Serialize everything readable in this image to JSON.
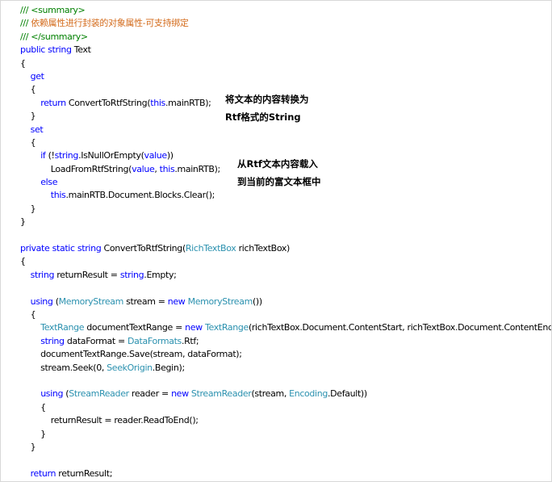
{
  "code_lines": [
    [
      {
        "t": "/// <summary>",
        "c": "cm"
      }
    ],
    [
      {
        "t": "/// ",
        "c": "cm"
      },
      {
        "t": "依赖属性进行封装的对象属性-可支持绑定",
        "c": "cm-cn"
      }
    ],
    [
      {
        "t": "/// </summary>",
        "c": "cm"
      }
    ],
    [
      {
        "t": "public",
        "c": "kw"
      },
      {
        "t": " "
      },
      {
        "t": "string",
        "c": "kw"
      },
      {
        "t": " Text"
      }
    ],
    [
      {
        "t": "{"
      }
    ],
    [
      {
        "t": "    "
      },
      {
        "t": "get",
        "c": "kw"
      }
    ],
    [
      {
        "t": "    {"
      }
    ],
    [
      {
        "t": "        "
      },
      {
        "t": "return",
        "c": "kw"
      },
      {
        "t": " ConvertToRtfString("
      },
      {
        "t": "this",
        "c": "kw"
      },
      {
        "t": ".mainRTB);"
      }
    ],
    [
      {
        "t": "    }"
      }
    ],
    [
      {
        "t": "    "
      },
      {
        "t": "set",
        "c": "kw"
      }
    ],
    [
      {
        "t": "    {"
      }
    ],
    [
      {
        "t": "        "
      },
      {
        "t": "if",
        "c": "kw"
      },
      {
        "t": " (!"
      },
      {
        "t": "string",
        "c": "kw"
      },
      {
        "t": ".IsNullOrEmpty("
      },
      {
        "t": "value",
        "c": "kw"
      },
      {
        "t": "))"
      }
    ],
    [
      {
        "t": "            LoadFromRtfString("
      },
      {
        "t": "value",
        "c": "kw"
      },
      {
        "t": ", "
      },
      {
        "t": "this",
        "c": "kw"
      },
      {
        "t": ".mainRTB);"
      }
    ],
    [
      {
        "t": "        "
      },
      {
        "t": "else",
        "c": "kw"
      }
    ],
    [
      {
        "t": "            "
      },
      {
        "t": "this",
        "c": "kw"
      },
      {
        "t": ".mainRTB.Document.Blocks.Clear();"
      }
    ],
    [
      {
        "t": "    }"
      }
    ],
    [
      {
        "t": "}"
      }
    ],
    [
      {
        "t": ""
      }
    ],
    [
      {
        "t": "private",
        "c": "kw"
      },
      {
        "t": " "
      },
      {
        "t": "static",
        "c": "kw"
      },
      {
        "t": " "
      },
      {
        "t": "string",
        "c": "kw"
      },
      {
        "t": " ConvertToRtfString("
      },
      {
        "t": "RichTextBox",
        "c": "ty"
      },
      {
        "t": " richTextBox)"
      }
    ],
    [
      {
        "t": "{"
      }
    ],
    [
      {
        "t": "    "
      },
      {
        "t": "string",
        "c": "kw"
      },
      {
        "t": " returnResult = "
      },
      {
        "t": "string",
        "c": "kw"
      },
      {
        "t": ".Empty;"
      }
    ],
    [
      {
        "t": ""
      }
    ],
    [
      {
        "t": "    "
      },
      {
        "t": "using",
        "c": "kw"
      },
      {
        "t": " ("
      },
      {
        "t": "MemoryStream",
        "c": "ty"
      },
      {
        "t": " stream = "
      },
      {
        "t": "new",
        "c": "kw"
      },
      {
        "t": " "
      },
      {
        "t": "MemoryStream",
        "c": "ty"
      },
      {
        "t": "())"
      }
    ],
    [
      {
        "t": "    {"
      }
    ],
    [
      {
        "t": "        "
      },
      {
        "t": "TextRange",
        "c": "ty"
      },
      {
        "t": " documentTextRange = "
      },
      {
        "t": "new",
        "c": "kw"
      },
      {
        "t": " "
      },
      {
        "t": "TextRange",
        "c": "ty"
      },
      {
        "t": "(richTextBox.Document.ContentStart, richTextBox.Document.ContentEnd);"
      }
    ],
    [
      {
        "t": "        "
      },
      {
        "t": "string",
        "c": "kw"
      },
      {
        "t": " dataFormat = "
      },
      {
        "t": "DataFormats",
        "c": "ty"
      },
      {
        "t": ".Rtf;"
      }
    ],
    [
      {
        "t": "        documentTextRange.Save(stream, dataFormat);"
      }
    ],
    [
      {
        "t": "        stream.Seek(0, "
      },
      {
        "t": "SeekOrigin",
        "c": "ty"
      },
      {
        "t": ".Begin);"
      }
    ],
    [
      {
        "t": ""
      }
    ],
    [
      {
        "t": "        "
      },
      {
        "t": "using",
        "c": "kw"
      },
      {
        "t": " ("
      },
      {
        "t": "StreamReader",
        "c": "ty"
      },
      {
        "t": " reader = "
      },
      {
        "t": "new",
        "c": "kw"
      },
      {
        "t": " "
      },
      {
        "t": "StreamReader",
        "c": "ty"
      },
      {
        "t": "(stream, "
      },
      {
        "t": "Encoding",
        "c": "ty"
      },
      {
        "t": ".Default))"
      }
    ],
    [
      {
        "t": "        {"
      }
    ],
    [
      {
        "t": "            returnResult = reader.ReadToEnd();"
      }
    ],
    [
      {
        "t": "        }"
      }
    ],
    [
      {
        "t": "    }"
      }
    ],
    [
      {
        "t": ""
      }
    ],
    [
      {
        "t": "    "
      },
      {
        "t": "return",
        "c": "kw"
      },
      {
        "t": " returnResult;"
      }
    ]
  ],
  "annotations": {
    "note1_line1": "将文本的内容转换为",
    "note1_line2": "Rtf格式的String",
    "note2_line1": "从Rtf文本内容载入",
    "note2_line2": "到当前的富文本框中"
  }
}
